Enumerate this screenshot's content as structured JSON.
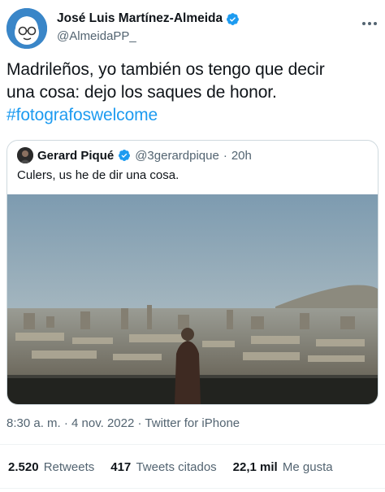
{
  "author": {
    "name": "José Luis Martínez-Almeida",
    "handle": "@AlmeidaPP_"
  },
  "tweet": {
    "line1": "Madrileños, yo también os tengo que decir",
    "line2": "una cosa: dejo los saques de honor.",
    "hashtag": "#fotografoswelcome"
  },
  "quoted": {
    "name": "Gerard Piqué",
    "handle": "@3gerardpique",
    "separator": "·",
    "time": "20h",
    "text": "Culers, us he de dir una cosa."
  },
  "meta": {
    "time": "8:30 a. m.",
    "date": "4 nov. 2022",
    "source": "Twitter for iPhone"
  },
  "stats": {
    "retweets_count": "2.520",
    "retweets_label": "Retweets",
    "quotes_count": "417",
    "quotes_label": "Tweets citados",
    "likes_count": "22,1 mil",
    "likes_label": "Me gusta"
  },
  "icons": {
    "verified": "verified-badge-icon",
    "more": "more-options-icon"
  },
  "colors": {
    "accent": "#1d9bf0",
    "text": "#0f1419",
    "secondary": "#536471"
  }
}
